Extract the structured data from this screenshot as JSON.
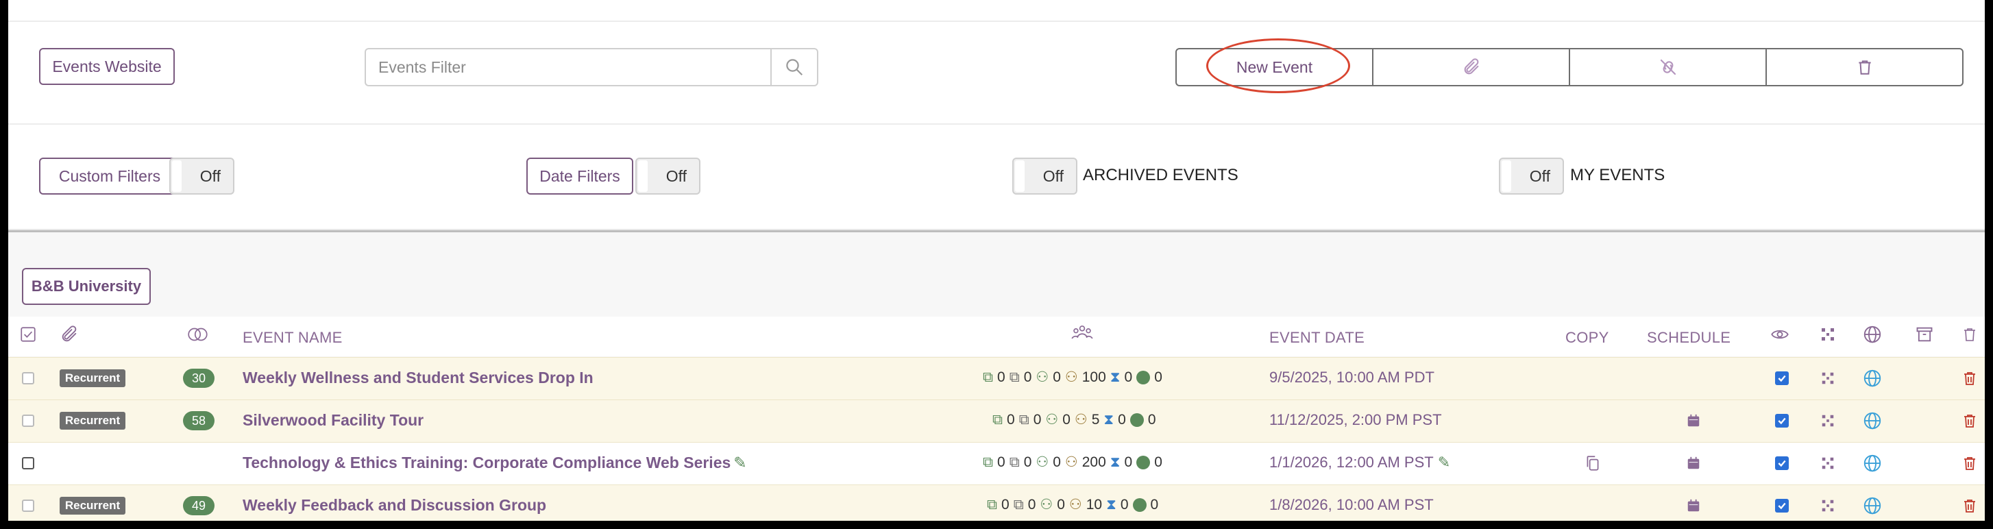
{
  "toolbar": {
    "events_website": "Events Website",
    "filter_placeholder": "Events Filter",
    "new_event": "New Event"
  },
  "filters": {
    "custom_filters": "Custom Filters",
    "custom_filters_state": "Off",
    "date_filters": "Date Filters",
    "date_filters_state": "Off",
    "archived_state": "Off",
    "archived_label": "ARCHIVED EVENTS",
    "my_events_state": "Off",
    "my_events_label": "MY EVENTS"
  },
  "group": {
    "label": "B&B University"
  },
  "columns": {
    "event_name": "EVENT NAME",
    "event_date": "EVENT DATE",
    "copy": "COPY",
    "schedule": "SCHEDULE"
  },
  "rows": [
    {
      "badge": "Recurrent",
      "count": "30",
      "name": "Weekly Wellness and Student Services Drop In",
      "stats": [
        "0",
        "0",
        "0",
        "100",
        "0",
        "0"
      ],
      "date": "9/5/2025, 10:00 AM PDT",
      "visible": true
    },
    {
      "badge": "Recurrent",
      "count": "58",
      "name": "Silverwood Facility Tour",
      "stats": [
        "0",
        "0",
        "0",
        "5",
        "0",
        "0"
      ],
      "date": "11/12/2025, 2:00 PM PST",
      "visible": true
    },
    {
      "badge": "",
      "count": "",
      "name": "Technology & Ethics Training: Corporate Compliance Web Series",
      "stats": [
        "0",
        "0",
        "0",
        "200",
        "0",
        "0"
      ],
      "date": "1/1/2026, 12:00 AM PST",
      "visible": true
    },
    {
      "badge": "Recurrent",
      "count": "49",
      "name": "Weekly Feedback and Discussion Group",
      "stats": [
        "0",
        "0",
        "0",
        "10",
        "0",
        "0"
      ],
      "date": "1/8/2026, 10:00 AM PST",
      "visible": true
    }
  ],
  "colors": {
    "accent": "#7a5a8a",
    "recurrent_row_bg": "#fbf7e7",
    "count_badge": "#5a8a5a",
    "annotation": "#d94530",
    "delete": "#c0392b",
    "globe": "#3aa0d8"
  },
  "icons": {
    "search": "search-icon",
    "attach": "paperclip-icon",
    "unlink": "unlink-icon",
    "delete": "trash-icon",
    "visibility": "eye-icon",
    "qr": "qr-icon",
    "web": "globe-icon",
    "archive": "archive-icon",
    "attendees": "people-icon",
    "schedule": "calendar-icon",
    "copy": "copy-icon",
    "edit": "edit-icon"
  }
}
